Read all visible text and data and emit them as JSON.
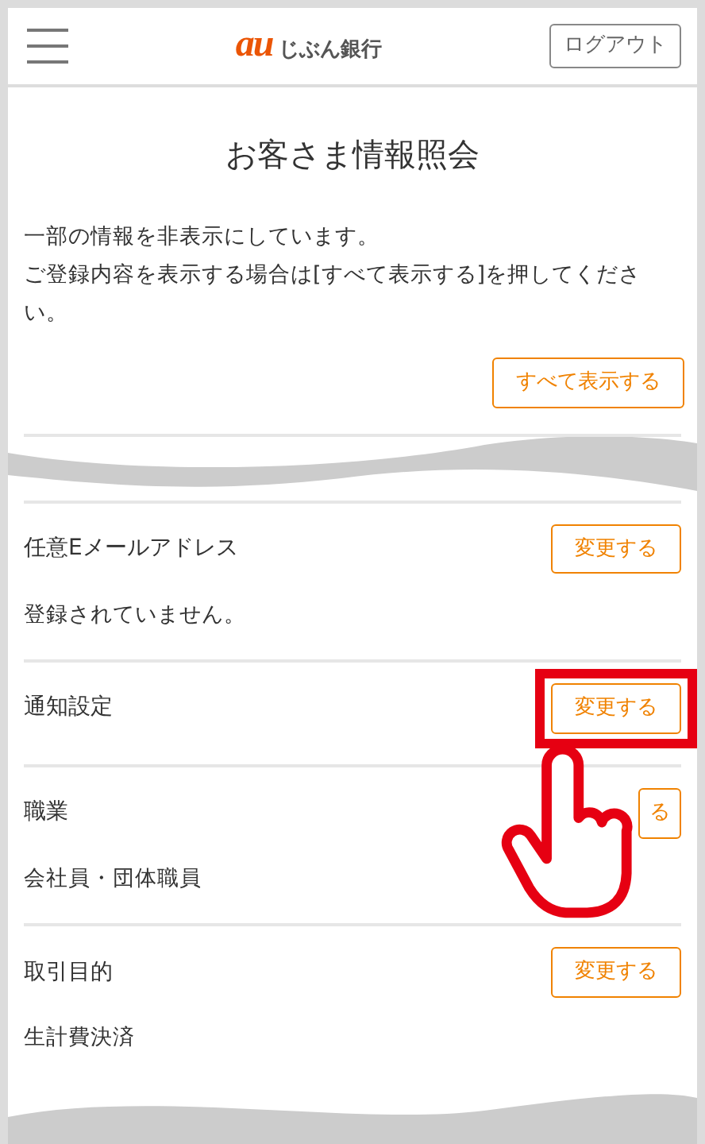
{
  "header": {
    "logo_mark": "au",
    "logo_text": "じぶん銀行",
    "logout": "ログアウト"
  },
  "title": "お客さま情報照会",
  "notice": {
    "lines": [
      "一部の情報を非表示にしています。",
      "ご登録内容を表示する場合は[すべて表示する]を押してください。"
    ],
    "button": "すべて表示する"
  },
  "sections": [
    {
      "label": "任意Eメールアドレス",
      "button": "変更する",
      "value": "登録されていません。",
      "highlighted": false
    },
    {
      "label": "通知設定",
      "button": "変更する",
      "highlighted": true
    },
    {
      "label": "職業",
      "button": "る",
      "value": "会社員・団体職員",
      "highlighted": false
    },
    {
      "label": "取引目的",
      "button": "変更する",
      "value": "生計費決済",
      "highlighted": false
    }
  ]
}
